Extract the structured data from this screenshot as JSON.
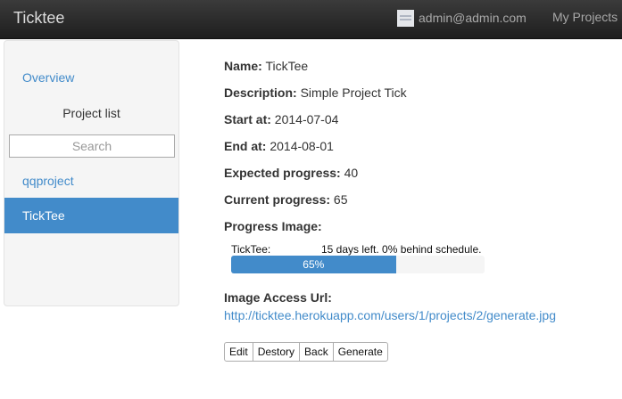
{
  "navbar": {
    "brand": "Ticktee",
    "user_email": "admin@admin.com",
    "my_projects": "My Projects"
  },
  "sidebar": {
    "overview": "Overview",
    "header": "Project list",
    "search_placeholder": "Search",
    "projects": [
      {
        "label": "qqproject",
        "active": false
      },
      {
        "label": "TickTee",
        "active": true
      }
    ]
  },
  "project": {
    "name_label": "Name:",
    "name": "TickTee",
    "description_label": "Description:",
    "description": "Simple Project Tick",
    "start_label": "Start at:",
    "start": "2014-07-04",
    "end_label": "End at:",
    "end": "2014-08-01",
    "expected_label": "Expected progress:",
    "expected": "40",
    "current_label": "Current progress:",
    "current": "65",
    "progress_image_label": "Progress Image:",
    "image_access_label": "Image Access Url:",
    "image_url": "http://ticktee.herokuapp.com/users/1/projects/2/generate.jpg"
  },
  "progress_image": {
    "project_name": "TickTee:",
    "status": "15 days left. 0% behind schedule.",
    "percent_text": "65%",
    "fill_fraction": 0.65,
    "fill_color": "#428bca"
  },
  "actions": {
    "edit": "Edit",
    "destroy": "Destory",
    "back": "Back",
    "generate": "Generate"
  },
  "colors": {
    "accent": "#428bca",
    "navbar_bg": "#262626"
  }
}
